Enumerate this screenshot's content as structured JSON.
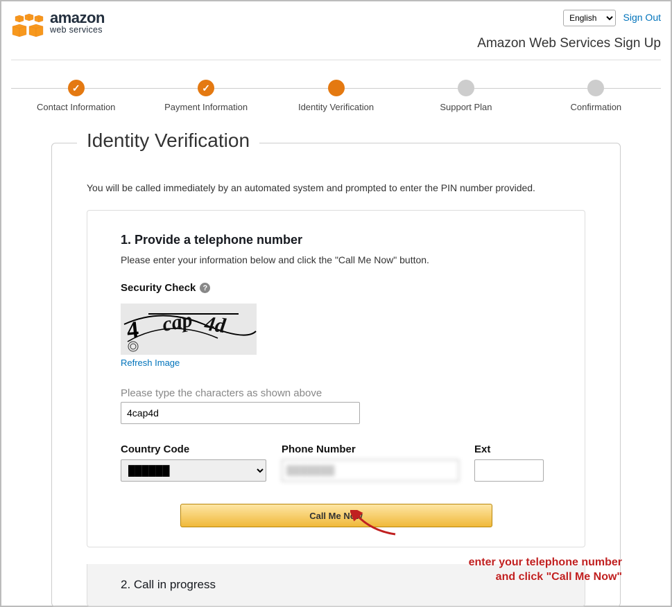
{
  "header": {
    "logo_main": "amazon",
    "logo_sub": "web services",
    "lang_selected": "English",
    "sign_out": "Sign Out",
    "page_subtitle": "Amazon Web Services Sign Up"
  },
  "stepper": {
    "steps": [
      {
        "label": "Contact Information",
        "state": "done"
      },
      {
        "label": "Payment Information",
        "state": "done"
      },
      {
        "label": "Identity Verification",
        "state": "current"
      },
      {
        "label": "Support Plan",
        "state": "pending"
      },
      {
        "label": "Confirmation",
        "state": "pending"
      }
    ]
  },
  "main": {
    "legend": "Identity Verification",
    "intro": "You will be called immediately by an automated system and prompted to enter the PIN number provided.",
    "card": {
      "title": "1. Provide a telephone number",
      "subtitle": "Please enter your information below and click the \"Call Me Now\" button.",
      "security_label": "Security Check",
      "captcha_text": "4cap4d",
      "refresh": "Refresh Image",
      "captcha_hint": "Please type the characters as shown above",
      "captcha_value": "4cap4d",
      "country_code_label": "Country Code",
      "country_code_value": "",
      "phone_label": "Phone Number",
      "phone_value": "",
      "ext_label": "Ext",
      "ext_value": "",
      "call_btn": "Call Me Now"
    },
    "step2_title": "2. Call in progress"
  },
  "annotation": {
    "line1": "enter your telephone number",
    "line2": "and click \"Call Me Now\""
  }
}
